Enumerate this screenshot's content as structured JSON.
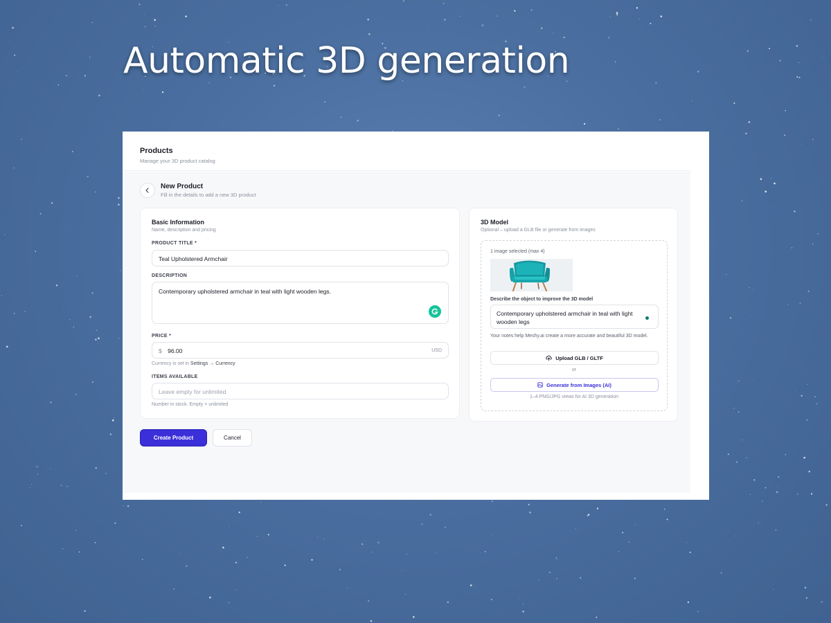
{
  "hero": {
    "title": "Automatic 3D generation"
  },
  "page": {
    "title": "Products",
    "subtitle": "Manage your 3D product catalog"
  },
  "new_product": {
    "title": "New Product",
    "subtitle": "Fill in the details to add a new 3D product"
  },
  "basic_info": {
    "title": "Basic Information",
    "subtitle": "Name, description and pricing",
    "product_title_label": "PRODUCT TITLE *",
    "product_title_value": "Teal Upholstered Armchair",
    "description_label": "DESCRIPTION",
    "description_value": "Contemporary upholstered armchair in teal with light wooden legs.",
    "price_label": "PRICE *",
    "price_symbol": "$",
    "price_value": "96.00",
    "price_currency": "USD",
    "currency_hint_prefix": "Currency is set in ",
    "currency_hint_link": "Settings → Currency",
    "items_label": "ITEMS AVAILABLE",
    "items_placeholder": "Leave empty for unlimited",
    "items_hint": "Number in stock. Empty = unlimited"
  },
  "model": {
    "title": "3D Model",
    "subtitle": "Optional – upload a GLB file or generate from images",
    "images_selected": "1 image selected (max 4)",
    "describe_label": "Describe the object to improve the 3D model",
    "describe_value": "Contemporary upholstered armchair in teal with light wooden legs",
    "notes_help": "Your notes help Meshy.ai create a more accurate and beautiful 3D model.",
    "upload_button": "Upload GLB / GLTF",
    "or_text": "or",
    "generate_button": "Generate from Images (AI)",
    "footer_hint": "1–4 PNG/JPG views for AI 3D generation"
  },
  "actions": {
    "create_label": "Create Product",
    "cancel_label": "Cancel"
  },
  "icons": {
    "back": "chevron-left-icon",
    "upload": "upload-cloud-icon",
    "generate": "image-icon",
    "grammarly": "grammarly-icon"
  },
  "colors": {
    "primary": "#3a2fd8",
    "background": "#4a6e9f",
    "chair": "#1bb5b8",
    "grammarly": "#15c39a"
  }
}
